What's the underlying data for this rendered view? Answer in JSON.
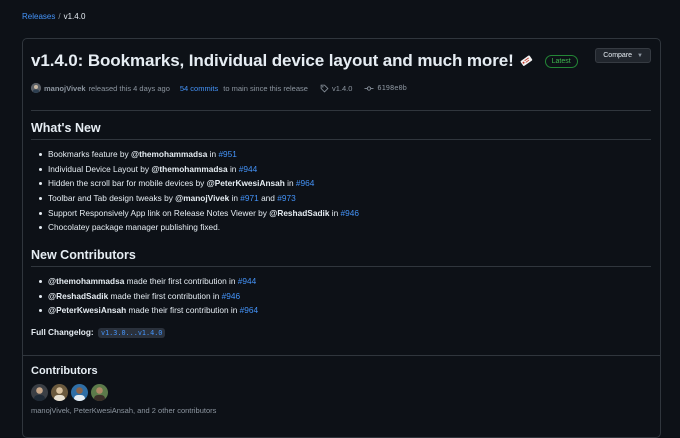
{
  "breadcrumb": {
    "parent": "Releases",
    "separator": "/",
    "current": "v1.4.0"
  },
  "release": {
    "title": "v1.4.0: Bookmarks, Individual device layout and much more!",
    "latest_badge": "Latest",
    "compare_label": "Compare",
    "author": "manojVivek",
    "released_text": "released this 4 days ago",
    "commits_link": "54 commits",
    "commits_suffix": "to main since this release",
    "tag": "v1.4.0",
    "commit_sha": "6198e0b"
  },
  "whats_new": {
    "heading": "What's New",
    "items": [
      {
        "text": "Bookmarks feature by ",
        "user": "@themohammadsa",
        "mid": " in ",
        "pr": "#951"
      },
      {
        "text": "Individual Device Layout by ",
        "user": "@themohammadsa",
        "mid": " in ",
        "pr": "#944"
      },
      {
        "text": "Hidden the scroll bar for mobile devices by ",
        "user": "@PeterKwesiAnsah",
        "mid": " in ",
        "pr": "#964"
      },
      {
        "text": "Toolbar and Tab design tweaks by ",
        "user": "@manojVivek",
        "mid": " in ",
        "pr": "#971",
        "and": " and ",
        "pr2": "#973"
      },
      {
        "text": "Support Responsively App link on Release Notes Viewer by ",
        "user": "@ReshadSadik",
        "mid": " in ",
        "pr": "#946"
      },
      {
        "text": "Chocolatey package manager publishing fixed."
      }
    ]
  },
  "new_contributors": {
    "heading": "New Contributors",
    "items": [
      {
        "user": "@themohammadsa",
        "text": " made their first contribution in ",
        "pr": "#944"
      },
      {
        "user": "@ReshadSadik",
        "text": " made their first contribution in ",
        "pr": "#946"
      },
      {
        "user": "@PeterKwesiAnsah",
        "text": " made their first contribution in ",
        "pr": "#964"
      }
    ]
  },
  "changelog": {
    "label": "Full Changelog:",
    "range": "v1.3.0...v1.4.0"
  },
  "contributors": {
    "heading": "Contributors",
    "summary": "manojVivek, PeterKwesiAnsah, and 2 other contributors",
    "avatar_colors": [
      "#3b3f45",
      "#6b5a3e",
      "#2f6ea5",
      "#5c7a4a"
    ]
  },
  "colors": {
    "accent": "#4493f8",
    "latest": "#3fb950",
    "background": "#0d1117",
    "border": "#30363d"
  },
  "icons": {
    "tag": "tag-icon",
    "commit": "git-commit-icon",
    "caret": "chevron-down-icon",
    "emoji": "label-emoji-icon"
  }
}
